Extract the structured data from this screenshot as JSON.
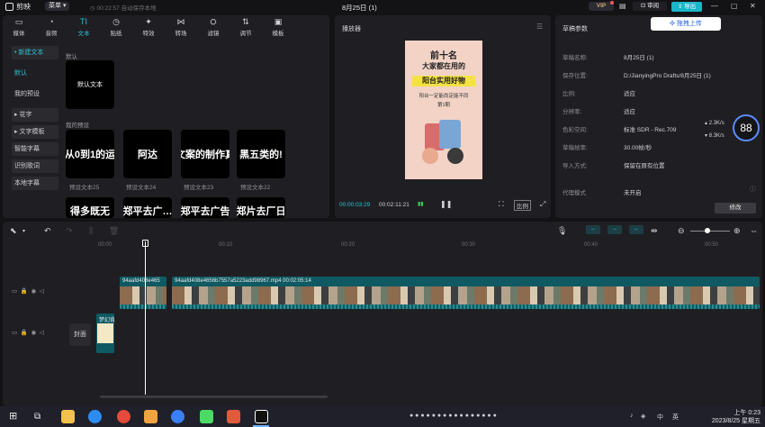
{
  "titlebar": {
    "app_name": "剪映",
    "menu_label": "菜单",
    "autosave": "00:22:57 自动保存本地",
    "doc_title": "8月25日 (1)",
    "vip": "VIP",
    "review": "审阅",
    "export": "导出"
  },
  "toolbar": [
    {
      "label": "媒体",
      "icon": "media-icon",
      "glyph": "▭"
    },
    {
      "label": "音频",
      "icon": "audio-icon",
      "glyph": "◔"
    },
    {
      "label": "文本",
      "icon": "text-icon",
      "glyph": "TI"
    },
    {
      "label": "贴纸",
      "icon": "sticker-icon",
      "glyph": "◷"
    },
    {
      "label": "特效",
      "icon": "effects-icon",
      "glyph": "✦"
    },
    {
      "label": "转场",
      "icon": "transition-icon",
      "glyph": "⋈"
    },
    {
      "label": "滤镜",
      "icon": "filter-icon",
      "glyph": "⛭"
    },
    {
      "label": "调节",
      "icon": "adjust-icon",
      "glyph": "⇅"
    },
    {
      "label": "模板",
      "icon": "template-icon",
      "glyph": "▣"
    }
  ],
  "sidenav": {
    "new_text": "• 新建文本",
    "default": "默认",
    "my_presets": "我的预设",
    "flower": "▸ 花字",
    "text_template": "▸ 文字模板",
    "smart_caption": "智能字幕",
    "recognize_lyrics": "识别歌词",
    "local_caption": "本地字幕"
  },
  "media": {
    "default_heading": "默认",
    "default_tile": "默认文本",
    "presets_heading": "我的预设",
    "tiles": [
      {
        "text": "从0到1的运",
        "caption": "预设文本25"
      },
      {
        "text": "阿达",
        "caption": "预设文本24"
      },
      {
        "text": "文案的制作真",
        "caption": "预设文本23"
      },
      {
        "text": "黑五类的!",
        "caption": "预设文本22"
      }
    ],
    "partial_row": [
      "得多既无",
      "郑平去广…",
      "郑平去广告",
      "郑片去厂日"
    ]
  },
  "player": {
    "title": "播放器",
    "preview": {
      "line1": "前十名",
      "line2": "大家都在用的",
      "line3": "阳台实用好物",
      "line4": "阳台一定能尚定能不同",
      "line5": "第1期"
    },
    "current_time": "00:00:03:29",
    "total_time": "00:02:11:21",
    "ratio": "比例"
  },
  "props": {
    "title": "草稿参数",
    "upload": "拖拽上传",
    "rows": [
      {
        "k": "草稿名称:",
        "v": "8月25日 (1)"
      },
      {
        "k": "保存位置:",
        "v": "D:/JianyingPro Drafts/8月25日 (1)"
      },
      {
        "k": "比例:",
        "v": "适应"
      },
      {
        "k": "分辨率:",
        "v": "适应"
      },
      {
        "k": "色彩空间:",
        "v": "标准 SDR - Rec.709"
      },
      {
        "k": "草稿帧率:",
        "v": "30.00帧/秒"
      },
      {
        "k": "导入方式:",
        "v": "保留在原有位置"
      }
    ],
    "proxy_k": "代理模式",
    "proxy_v": "未开启",
    "modify": "修改",
    "net_up": "2.3K/s",
    "net_down": "8.3K/s",
    "gauge": "88"
  },
  "timeline": {
    "ruler": [
      "00:00",
      "00:10",
      "00:20",
      "00:30",
      "00:40",
      "00:50"
    ],
    "clip1_label": "94aafd408e465",
    "clip2_label": "94aafd408e4656b7557a5223add98967.mp4  00:02:05:14",
    "cover": "封面",
    "cover_clip_label": "梦幻背"
  },
  "taskbar": {
    "time": "上午 0:23",
    "date": "2023/8/25 星期五",
    "ime": "中",
    "lang": "英"
  }
}
